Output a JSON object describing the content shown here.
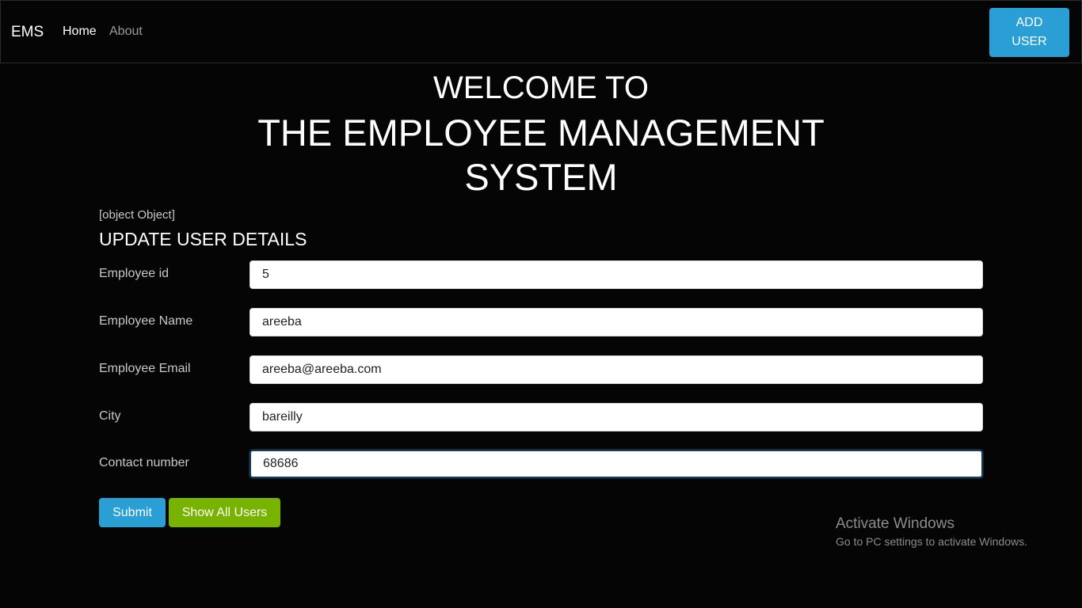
{
  "navbar": {
    "brand": "EMS",
    "links": [
      {
        "label": "Home",
        "active": true
      },
      {
        "label": "About",
        "active": false
      }
    ],
    "add_user_line1": "ADD",
    "add_user_line2": "USER"
  },
  "header": {
    "line1": "WELCOME TO",
    "line2": "THE EMPLOYEE MANAGEMENT",
    "line3": "SYSTEM"
  },
  "debug_text": "[object Object]",
  "form": {
    "title": "UPDATE USER DETAILS",
    "fields": [
      {
        "label": "Employee id",
        "value": "5"
      },
      {
        "label": "Employee Name",
        "value": "areeba"
      },
      {
        "label": "Employee Email",
        "value": "areeba@areeba.com"
      },
      {
        "label": "City",
        "value": "bareilly"
      },
      {
        "label": "Contact number",
        "value": "68686",
        "focused": true
      }
    ],
    "submit_label": "Submit",
    "show_all_label": "Show All Users"
  },
  "watermark": {
    "title": "Activate Windows",
    "subtitle": "Go to PC settings to activate Windows."
  },
  "colors": {
    "background": "#050505",
    "primary": "#2a9fd6",
    "success": "#77b300"
  }
}
